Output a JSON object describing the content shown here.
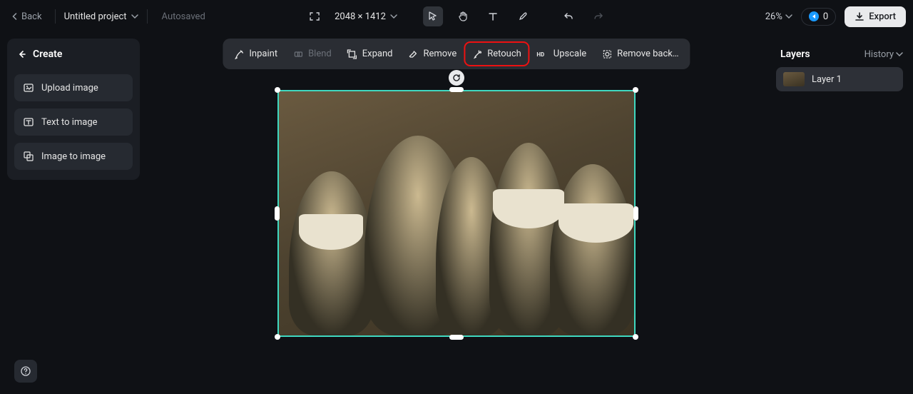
{
  "topbar": {
    "back_label": "Back",
    "project_name": "Untitled project",
    "autosaved_label": "Autosaved",
    "dimensions": "2048 × 1412",
    "zoom_label": "26%",
    "credits_count": "0",
    "export_label": "Export"
  },
  "tools_pill": {
    "inpaint": "Inpaint",
    "blend": "Blend",
    "expand": "Expand",
    "remove": "Remove",
    "retouch": "Retouch",
    "upscale": "Upscale",
    "remove_bg": "Remove back…"
  },
  "left": {
    "create_header": "Create",
    "upload_image": "Upload image",
    "text_to_image": "Text to image",
    "image_to_image": "Image to image"
  },
  "right": {
    "layers_title": "Layers",
    "history_label": "History",
    "layer1_name": "Layer 1"
  }
}
